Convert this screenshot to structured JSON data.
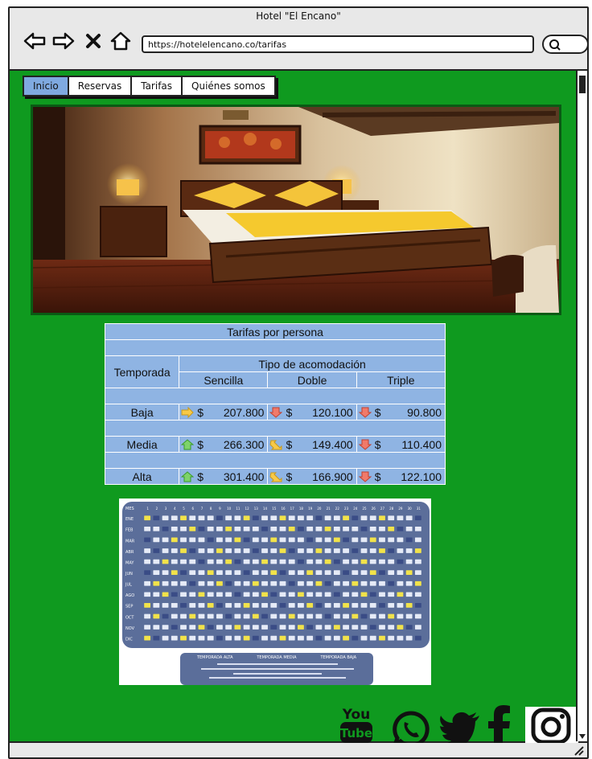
{
  "window": {
    "title": "Hotel \"El Encano\""
  },
  "browser": {
    "url": "https://hotelelencano.co/tarifas"
  },
  "nav": {
    "tabs": [
      {
        "label": "Inicio",
        "active": true
      },
      {
        "label": "Reservas",
        "active": false
      },
      {
        "label": "Tarifas",
        "active": false
      },
      {
        "label": "Quiénes somos",
        "active": false
      }
    ]
  },
  "rates": {
    "title": "Tarifas por persona",
    "col_temporada": "Temporada",
    "col_tipo": "Tipo de acomodación",
    "types": [
      "Sencilla",
      "Doble",
      "Triple"
    ],
    "currency": "$",
    "rows": [
      {
        "season": "Baja",
        "prices": [
          "207.800",
          "120.100",
          "90.800"
        ],
        "trend": [
          "right",
          "down",
          "down"
        ]
      },
      {
        "season": "Media",
        "prices": [
          "266.300",
          "149.400",
          "110.400"
        ],
        "trend": [
          "up",
          "diag",
          "down"
        ]
      },
      {
        "season": "Alta",
        "prices": [
          "301.400",
          "166.900",
          "122.100"
        ],
        "trend": [
          "up",
          "diag",
          "down"
        ]
      }
    ]
  },
  "calendar": {
    "months": [
      "ENE",
      "FEB",
      "MAR",
      "ABR",
      "MAY",
      "JUN",
      "JUL",
      "AGO",
      "SEP",
      "OCT",
      "NOV",
      "DIC"
    ],
    "header": "MES",
    "legend": [
      "TEMPORADA ALTA",
      "TEMPORADA MEDIA",
      "TEMPORADA BAJA"
    ]
  },
  "social": {
    "youtube_label": "You Tube",
    "icons": [
      "youtube-icon",
      "whatsapp-icon",
      "twitter-icon",
      "facebook-icon",
      "instagram-icon"
    ]
  },
  "colors": {
    "page_bg": "#0f9a1f",
    "table_cell": "#8fb4e3",
    "active_tab": "#7fa9e0",
    "calendar_bg": "#5b6e9a"
  }
}
